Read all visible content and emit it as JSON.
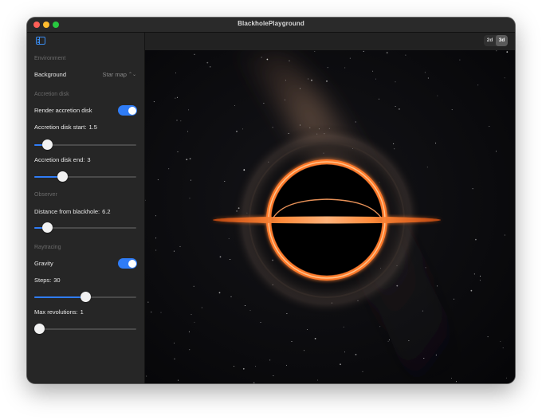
{
  "window": {
    "title": "BlackholePlayground"
  },
  "sidebar": {
    "environment": {
      "header": "Environment",
      "background_label": "Background",
      "background_value": "Star map"
    },
    "accretion": {
      "header": "Accretion disk",
      "render_label": "Render accretion disk",
      "render_on": true,
      "start_label": "Accretion disk start:",
      "start_value": "1.5",
      "start_fraction": 0.09,
      "end_label": "Accretion disk end:",
      "end_value": "3",
      "end_fraction": 0.25
    },
    "observer": {
      "header": "Observer",
      "distance_label": "Distance from blackhole:",
      "distance_value": "6.2",
      "distance_fraction": 0.09
    },
    "raytracing": {
      "header": "Raytracing",
      "gravity_label": "Gravity",
      "gravity_on": true,
      "steps_label": "Steps:",
      "steps_value": "30",
      "steps_fraction": 0.5,
      "revolutions_label": "Max revolutions:",
      "revolutions_value": "1",
      "revolutions_fraction": 0.0
    }
  },
  "toolbar": {
    "mode_2d": "2d",
    "mode_3d": "3d",
    "selected": "3d"
  },
  "colors": {
    "accent": "#2f7cf6",
    "disk_glow": "#ff7a2a",
    "disk_core": "#ffd0a0"
  },
  "icons": {
    "sidebar_toggle": "sidebar-toggle-icon",
    "popup_chevron": "chevron-updown-icon"
  }
}
